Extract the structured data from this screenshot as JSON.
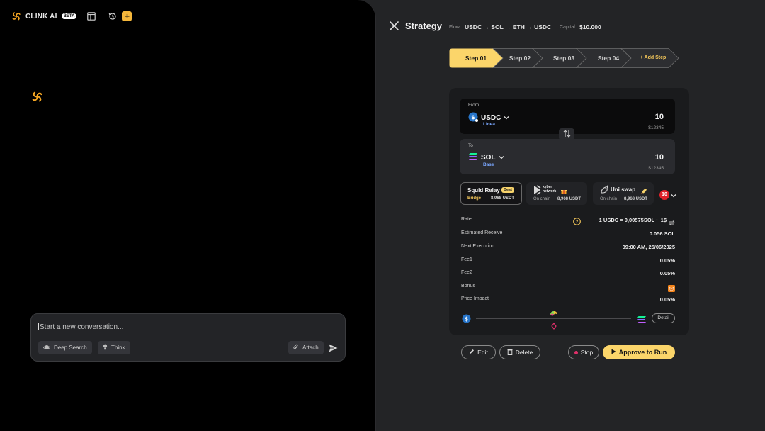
{
  "brand": {
    "name": "CLINK AI",
    "badge": "BETA"
  },
  "composer": {
    "placeholder": "Start a new conversation...",
    "deep_search": "Deep Search",
    "think": "Think",
    "attach": "Attach"
  },
  "strategy": {
    "title": "Strategy",
    "flow_label": "Flow",
    "flow_value": "USDC → SOL → ETH → USDC",
    "capital_label": "Capital",
    "capital_value": "$10.000"
  },
  "steps": [
    "Step 01",
    "Step 02",
    "Step 03",
    "Step 04",
    "+ Add Step"
  ],
  "swap": {
    "from": {
      "label": "From",
      "token": "USDC",
      "chain": "Linea",
      "amount": "10",
      "usd": "$12345"
    },
    "to": {
      "label": "To",
      "token": "SOL",
      "chain": "Base",
      "amount": "10",
      "usd": "$12345"
    }
  },
  "routes": [
    {
      "name": "Squid Relay",
      "badge": "Best",
      "type": "Bridge",
      "value": "8,968 USDT"
    },
    {
      "name": "kyber network",
      "type": "On chain",
      "value": "8,968 USDT"
    },
    {
      "name": "Uni swap",
      "type": "On chain",
      "value": "8,968 USDT"
    }
  ],
  "routes_more": "10",
  "details": {
    "rate_label": "Rate",
    "rate_value": "1 USDC = 0,00575SOL ~ 1$",
    "receive_label": "Estimated Receive",
    "receive_value": "0.056 SOL",
    "next_label": "Next Execution",
    "next_value": "09:00 AM, 25/06/2025",
    "fee1_label": "Fee1",
    "fee1_value": "0.05%",
    "fee2_label": "Fee2",
    "fee2_value": "0.05%",
    "bonus_label": "Bonus",
    "impact_label": "Price Impact",
    "impact_value": "0.05%"
  },
  "detail_btn": "Detail",
  "actions": {
    "edit": "Edit",
    "delete": "Delete",
    "stop": "Stop",
    "approve": "Approve to Run"
  },
  "colors": {
    "accent": "#fbd56a",
    "step_active": "#fbd56a",
    "usdc": "#2775ca",
    "sol": "#9945ff",
    "danger": "#e0202a"
  }
}
